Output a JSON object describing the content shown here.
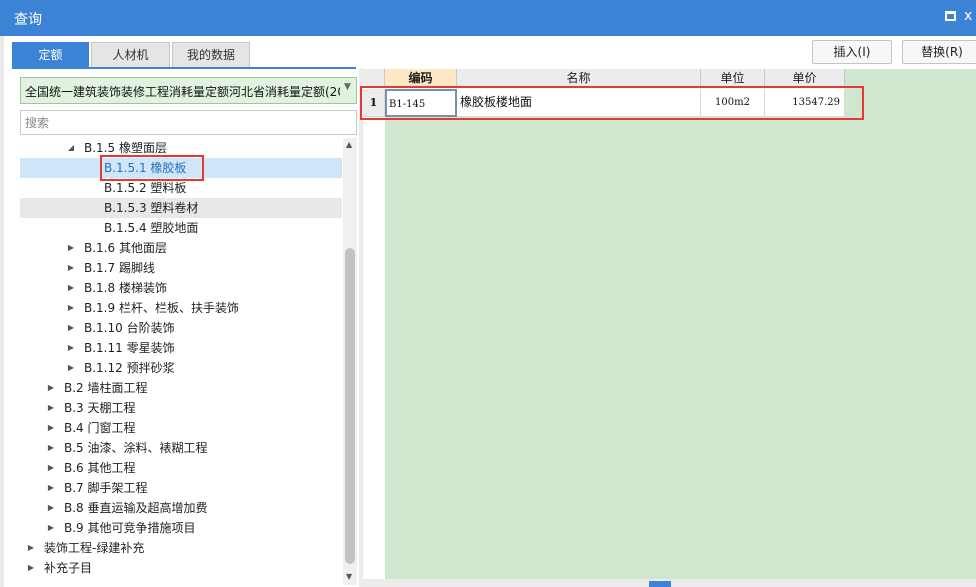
{
  "window": {
    "title": "查询",
    "maximize_icon": "maximize-icon",
    "close_glyph": "x"
  },
  "tabs": [
    {
      "label": "定额",
      "active": true
    },
    {
      "label": "人材机",
      "active": false
    },
    {
      "label": "我的数据",
      "active": false
    }
  ],
  "toolbar": {
    "insert_label": "插入(I)",
    "replace_label": "替换(R)"
  },
  "library_select": {
    "value": "全国统一建筑装饰装修工程消耗量定额河北省消耗量定额(20"
  },
  "search": {
    "placeholder": "搜索",
    "value": ""
  },
  "tree": {
    "nodes": [
      {
        "label": "B.1.5 橡塑面层",
        "expanded": true
      },
      {
        "label": "B.1.5.1 橡胶板",
        "selected": true
      },
      {
        "label": "B.1.5.2 塑料板"
      },
      {
        "label": "B.1.5.3 塑料卷材",
        "hovered": true
      },
      {
        "label": "B.1.5.4 塑胶地面"
      },
      {
        "label": "B.1.6 其他面层"
      },
      {
        "label": "B.1.7 踢脚线"
      },
      {
        "label": "B.1.8 楼梯装饰"
      },
      {
        "label": "B.1.9 栏杆、栏板、扶手装饰"
      },
      {
        "label": "B.1.10 台阶装饰"
      },
      {
        "label": "B.1.11 零星装饰"
      },
      {
        "label": "B.1.12 预拌砂浆"
      },
      {
        "label": "B.2 墙柱面工程"
      },
      {
        "label": "B.3 天棚工程"
      },
      {
        "label": "B.4 门窗工程"
      },
      {
        "label": "B.5 油漆、涂料、裱糊工程"
      },
      {
        "label": "B.6 其他工程"
      },
      {
        "label": "B.7 脚手架工程"
      },
      {
        "label": "B.8 垂直运输及超高增加费"
      },
      {
        "label": "B.9 其他可竞争措施项目"
      },
      {
        "label": "装饰工程-绿建补充"
      },
      {
        "label": "补充子目"
      }
    ]
  },
  "grid": {
    "columns": [
      "编码",
      "名称",
      "单位",
      "单价"
    ],
    "rows": [
      {
        "num": "1",
        "code": "B1-145",
        "name": "橡胶板楼地面",
        "unit": "100m2",
        "price": "13547.29"
      }
    ]
  },
  "colors": {
    "accent": "#3c83d6",
    "highlight_red": "#e53935",
    "grid_green": "#cfe7cf",
    "select_green": "#e1f3df"
  }
}
